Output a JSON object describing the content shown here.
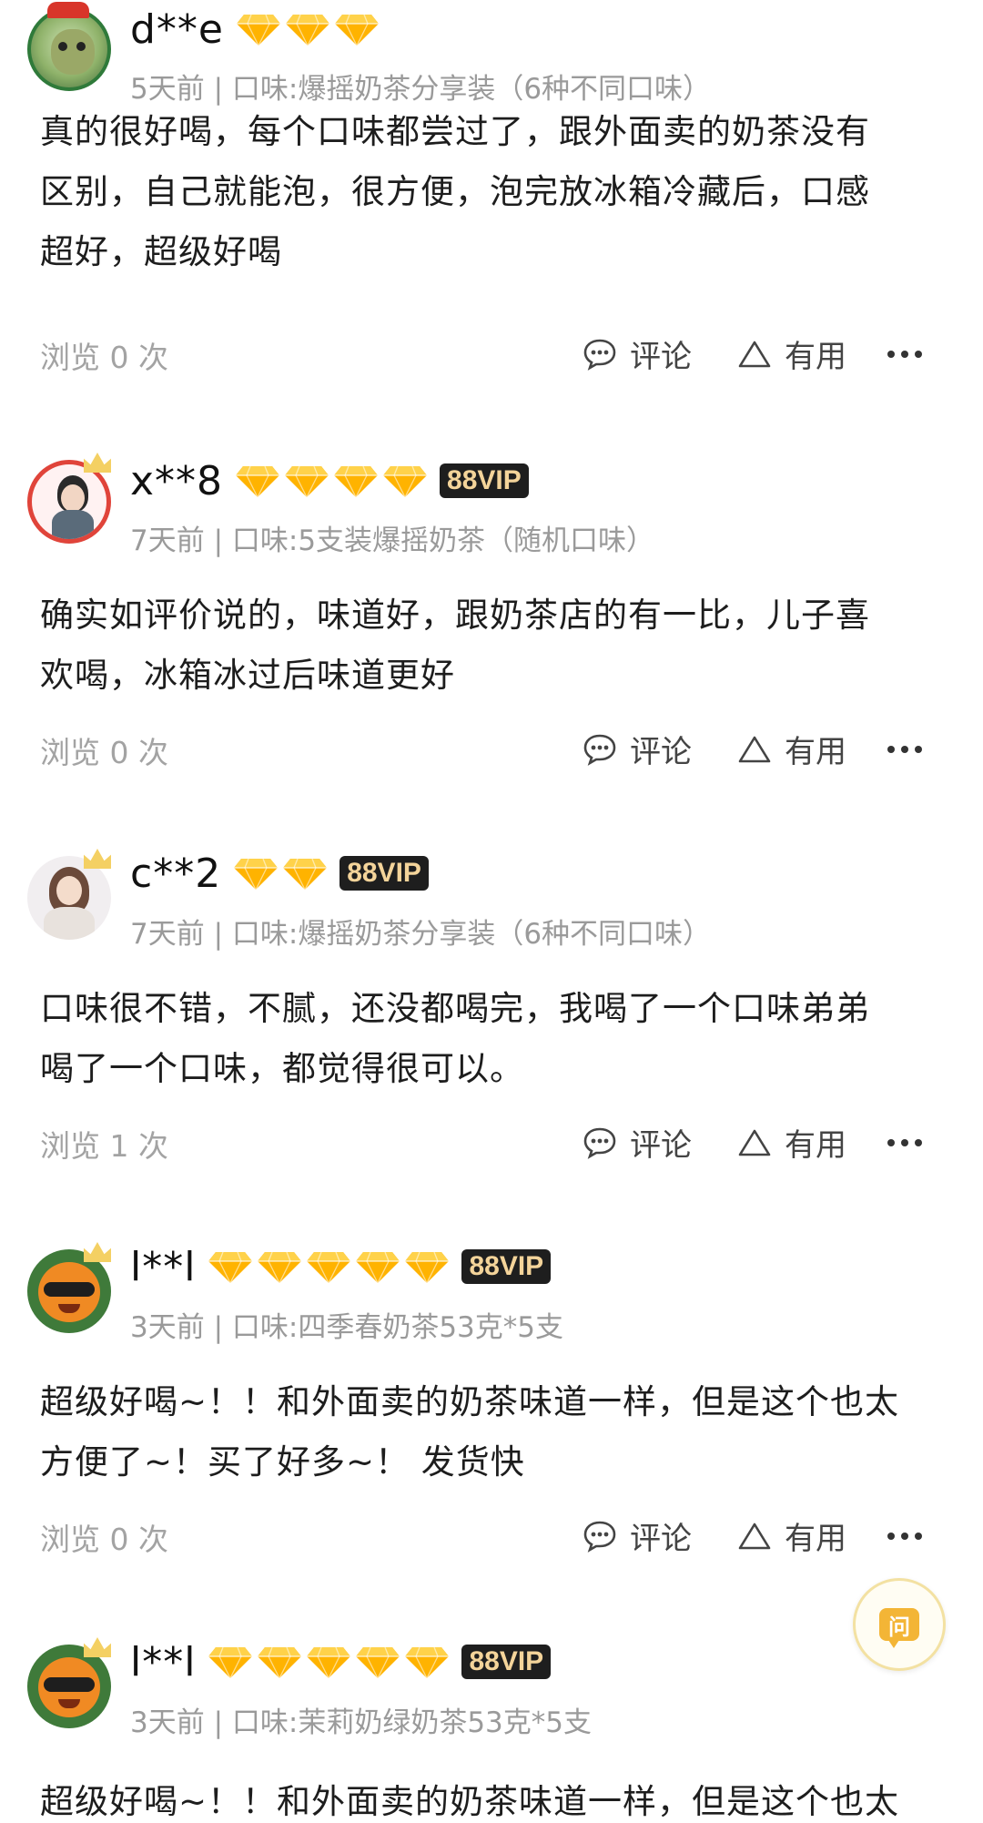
{
  "colors": {
    "diamond": "#ffb300",
    "vip_bg": "#1e1e1e",
    "vip_text": "#f4d49a",
    "meta": "#9a9a9a"
  },
  "actions": {
    "comment_label": "评论",
    "useful_label": "有用"
  },
  "reviews": [
    {
      "name": "d**e",
      "diamonds": 3,
      "vip": "",
      "meta": "5天前 | 口味:爆摇奶茶分享装（6种不同口味）",
      "content": [
        "真的很好喝，每个口味都尝过了，跟外面卖的奶茶没有",
        "区别，自己就能泡，很方便，泡完放冰箱冷藏后，口感",
        "超好，超级好喝"
      ],
      "views": "浏览 0 次"
    },
    {
      "name": "x**8",
      "diamonds": 4,
      "vip": "88VIP",
      "meta": "7天前 | 口味:5支装爆摇奶茶（随机口味）",
      "content": [
        "确实如评价说的，味道好，跟奶茶店的有一比，儿子喜",
        "欢喝，冰箱冰过后味道更好"
      ],
      "views": "浏览 0 次"
    },
    {
      "name": "c**2",
      "diamonds": 2,
      "vip": "88VIP",
      "meta": "7天前 | 口味:爆摇奶茶分享装（6种不同口味）",
      "content": [
        "口味很不错，不腻，还没都喝完，我喝了一个口味弟弟",
        "喝了一个口味，都觉得很可以。"
      ],
      "views": "浏览 1 次"
    },
    {
      "name": "l**l",
      "diamonds": 5,
      "vip": "88VIP",
      "meta": "3天前 | 口味:四季春奶茶53克*5支",
      "content": [
        "超级好喝~！！和外面卖的奶茶味道一样，但是这个也太",
        "方便了~！买了好多~！ 发货快"
      ],
      "views": "浏览 0 次"
    },
    {
      "name": "l**l",
      "diamonds": 5,
      "vip": "88VIP",
      "meta": "3天前 | 口味:茉莉奶绿奶茶53克*5支",
      "content": [
        "超级好喝~！！和外面卖的奶茶味道一样，但是这个也太"
      ],
      "views": ""
    }
  ],
  "float_button": {
    "label": "问",
    "icon": "question-bubble-icon"
  }
}
